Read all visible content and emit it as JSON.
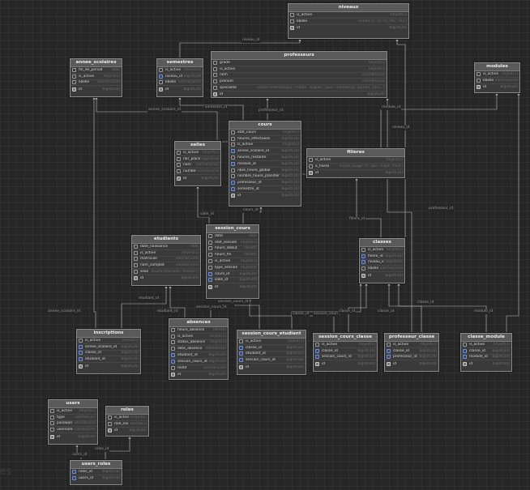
{
  "watermark": "les",
  "tables": [
    {
      "name": "niveaux",
      "fields": [
        {
          "name": "is_active",
          "type": "tinyint(1)",
          "key": ""
        },
        {
          "name": "libelle",
          "type": "enum('l1','l2','l3','m1','m2')",
          "key": ""
        },
        {
          "name": "id",
          "type": "bigint(20)",
          "key": "pk"
        }
      ]
    },
    {
      "name": "annee_scolaires",
      "fields": [
        {
          "name": "fin_de_period",
          "type": "date",
          "key": ""
        },
        {
          "name": "is_active",
          "type": "tinyint(1)",
          "key": ""
        },
        {
          "name": "libelle",
          "type": "varchar(255)",
          "key": ""
        },
        {
          "name": "id",
          "type": "bigint(20)",
          "key": "pk"
        }
      ]
    },
    {
      "name": "semestres",
      "fields": [
        {
          "name": "is_active",
          "type": "tinyint(1)",
          "key": ""
        },
        {
          "name": "niveau_id",
          "type": "bigint(20)",
          "key": "fk"
        },
        {
          "name": "libelle",
          "type": "varchar(255)",
          "key": ""
        },
        {
          "name": "id",
          "type": "bigint(20)",
          "key": "pk"
        }
      ]
    },
    {
      "name": "professeurs",
      "fields": [
        {
          "name": "grade",
          "type": "tinyint(1)",
          "key": ""
        },
        {
          "name": "is_active",
          "type": "tinyint(1)",
          "key": ""
        },
        {
          "name": "nom",
          "type": "varchar(255)",
          "key": ""
        },
        {
          "name": "prenom",
          "type": "varchar(255)",
          "key": ""
        },
        {
          "name": "specialite",
          "type": "enum('informatique','marke','anglais','java','marketing','python','phil...')",
          "key": ""
        },
        {
          "name": "id",
          "type": "bigint(20)",
          "key": "pk"
        }
      ]
    },
    {
      "name": "modules",
      "fields": [
        {
          "name": "is_active",
          "type": "tinyint(1)",
          "key": ""
        },
        {
          "name": "libelle",
          "type": "varchar(255)",
          "key": ""
        },
        {
          "name": "id",
          "type": "bigint(20)",
          "key": "pk"
        }
      ]
    },
    {
      "name": "cours",
      "fields": [
        {
          "name": "etat_cours",
          "type": "tinyint(1)",
          "key": ""
        },
        {
          "name": "heures_effectuees",
          "type": "bigint(20)",
          "key": ""
        },
        {
          "name": "is_active",
          "type": "tinyint(1)",
          "key": ""
        },
        {
          "name": "annee_scolaire_id",
          "type": "bigint(20)",
          "key": "fk"
        },
        {
          "name": "heures_restante",
          "type": "bigint(20)",
          "key": ""
        },
        {
          "name": "module_id",
          "type": "bigint(20)",
          "key": "fk"
        },
        {
          "name": "nbre_heure_global",
          "type": "bigint(20)",
          "key": ""
        },
        {
          "name": "nombre_heure_planifier",
          "type": "bigint(20)",
          "key": ""
        },
        {
          "name": "professeur_id",
          "type": "bigint(20)",
          "key": "fk"
        },
        {
          "name": "semestre_id",
          "type": "bigint(20)",
          "key": "fk"
        },
        {
          "name": "id",
          "type": "bigint(20)",
          "key": "pk"
        }
      ]
    },
    {
      "name": "salles",
      "fields": [
        {
          "name": "is_active",
          "type": "tinyint(1)",
          "key": ""
        },
        {
          "name": "nbr_place",
          "type": "bigint(20)",
          "key": ""
        },
        {
          "name": "nom",
          "type": "varchar(255)",
          "key": ""
        },
        {
          "name": "number",
          "type": "varchar(255)",
          "key": ""
        },
        {
          "name": "id",
          "type": "bigint(20)",
          "key": "pk"
        }
      ]
    },
    {
      "name": "filieres",
      "fields": [
        {
          "name": "is_active",
          "type": "tinyint(1)",
          "key": ""
        },
        {
          "name": "e_filiere",
          "type": "enum('usage','tl','gnc','mspt','tdsd')",
          "key": ""
        },
        {
          "name": "id",
          "type": "bigint(20)",
          "key": "pk"
        }
      ]
    },
    {
      "name": "session_cours",
      "fields": [
        {
          "name": "date",
          "type": "date",
          "key": ""
        },
        {
          "name": "etat_session",
          "type": "tinyint(1)",
          "key": ""
        },
        {
          "name": "heure_debut",
          "type": "time(6)",
          "key": ""
        },
        {
          "name": "heure_fin",
          "type": "time(6)",
          "key": ""
        },
        {
          "name": "is_active",
          "type": "tinyint(1)",
          "key": ""
        },
        {
          "name": "type_session",
          "type": "tinyint(4)",
          "key": ""
        },
        {
          "name": "cours_id",
          "type": "bigint(20)",
          "key": "fk"
        },
        {
          "name": "salle_id",
          "type": "bigint(20)",
          "key": "fk"
        },
        {
          "name": "id",
          "type": "bigint(20)",
          "key": "pk"
        }
      ]
    },
    {
      "name": "etudiants",
      "fields": [
        {
          "name": "date_naissance",
          "type": "date",
          "key": ""
        },
        {
          "name": "is_active",
          "type": "tinyint(1)",
          "key": ""
        },
        {
          "name": "matricule",
          "type": "varchar(255)",
          "key": ""
        },
        {
          "name": "nom_complet",
          "type": "varchar(255)",
          "key": ""
        },
        {
          "name": "sexe",
          "type": "enum('masculin','feminin')",
          "key": ""
        },
        {
          "name": "id",
          "type": "bigint(20)",
          "key": "pk"
        }
      ]
    },
    {
      "name": "classes",
      "fields": [
        {
          "name": "is_active",
          "type": "tinyint(1)",
          "key": ""
        },
        {
          "name": "filiere_id",
          "type": "bigint(20)",
          "key": "fk"
        },
        {
          "name": "niveau_id",
          "type": "bigint(20)",
          "key": "fk"
        },
        {
          "name": "libelle",
          "type": "varchar(255)",
          "key": ""
        },
        {
          "name": "id",
          "type": "bigint(20)",
          "key": "pk"
        }
      ]
    },
    {
      "name": "inscriptions",
      "fields": [
        {
          "name": "is_active",
          "type": "tinyint(1)",
          "key": ""
        },
        {
          "name": "annee_scolaire_id",
          "type": "bigint(20)",
          "key": "fk"
        },
        {
          "name": "classe_id",
          "type": "bigint(20)",
          "key": "fk"
        },
        {
          "name": "etudiant_id",
          "type": "bigint(20)",
          "key": "fk"
        },
        {
          "name": "id",
          "type": "bigint(20)",
          "key": "pk"
        }
      ]
    },
    {
      "name": "absences",
      "fields": [
        {
          "name": "heure_absence",
          "type": "time(6)",
          "key": ""
        },
        {
          "name": "is_active",
          "type": "tinyint(1)",
          "key": ""
        },
        {
          "name": "status_absence",
          "type": "tinyint(1)",
          "key": ""
        },
        {
          "name": "date_absence",
          "type": "datetime(6)",
          "key": ""
        },
        {
          "name": "etudiant_id",
          "type": "bigint(20)",
          "key": "fk"
        },
        {
          "name": "session_cours_id",
          "type": "bigint(20)",
          "key": "fk"
        },
        {
          "name": "motif",
          "type": "varchar(255)",
          "key": ""
        },
        {
          "name": "id",
          "type": "bigint(20)",
          "key": "pk"
        }
      ]
    },
    {
      "name": "session_cours_etudiant",
      "fields": [
        {
          "name": "is_active",
          "type": "tinyint(1)",
          "key": ""
        },
        {
          "name": "classe_id",
          "type": "bigint(20)",
          "key": "fk"
        },
        {
          "name": "etudiant_id",
          "type": "bigint(20)",
          "key": "fk"
        },
        {
          "name": "session_cours_id",
          "type": "bigint(20)",
          "key": "fk"
        },
        {
          "name": "id",
          "type": "bigint(20)",
          "key": "pk"
        }
      ]
    },
    {
      "name": "session_cours_classe",
      "fields": [
        {
          "name": "is_active",
          "type": "tinyint(1)",
          "key": ""
        },
        {
          "name": "classe_id",
          "type": "bigint(20)",
          "key": "fk"
        },
        {
          "name": "session_cours_id",
          "type": "bigint(20)",
          "key": "fk"
        },
        {
          "name": "id",
          "type": "bigint(20)",
          "key": "pk"
        }
      ]
    },
    {
      "name": "professeur_classe",
      "fields": [
        {
          "name": "is_active",
          "type": "tinyint(1)",
          "key": ""
        },
        {
          "name": "classe_id",
          "type": "bigint(20)",
          "key": "fk"
        },
        {
          "name": "professeur_id",
          "type": "bigint(20)",
          "key": "fk"
        },
        {
          "name": "id",
          "type": "bigint(20)",
          "key": "pk"
        }
      ]
    },
    {
      "name": "classe_module",
      "fields": [
        {
          "name": "is_active",
          "type": "tinyint(1)",
          "key": ""
        },
        {
          "name": "classe_id",
          "type": "bigint(20)",
          "key": "fk"
        },
        {
          "name": "module_id",
          "type": "bigint(20)",
          "key": "fk"
        },
        {
          "name": "id",
          "type": "bigint(20)",
          "key": "pk"
        }
      ]
    },
    {
      "name": "users",
      "fields": [
        {
          "name": "is_active",
          "type": "tinyint(1)",
          "key": ""
        },
        {
          "name": "type",
          "type": "varchar(31)",
          "key": ""
        },
        {
          "name": "password",
          "type": "varchar(255)",
          "key": ""
        },
        {
          "name": "username",
          "type": "varchar(255)",
          "key": ""
        },
        {
          "name": "id",
          "type": "bigint(20)",
          "key": "pk"
        }
      ]
    },
    {
      "name": "roles",
      "fields": [
        {
          "name": "is_active",
          "type": "tinyint(1)",
          "key": ""
        },
        {
          "name": "role_name",
          "type": "varchar(255)",
          "key": ""
        },
        {
          "name": "id",
          "type": "bigint(20)",
          "key": "pk"
        }
      ]
    },
    {
      "name": "users_roles",
      "fields": [
        {
          "name": "roles_id",
          "type": "bigint(20)",
          "key": "fk"
        },
        {
          "name": "users_id",
          "type": "bigint(20)",
          "key": "fk"
        }
      ]
    }
  ],
  "relationships": [
    {
      "label": "niveau_id",
      "from": "semestres",
      "to": "niveaux"
    },
    {
      "label": "niveau_id",
      "from": "classes",
      "to": "niveaux"
    },
    {
      "label": "annee_scolaire_id",
      "from": "cours",
      "to": "annee_scolaires"
    },
    {
      "label": "semestre_id",
      "from": "cours",
      "to": "semestres"
    },
    {
      "label": "professeur_id",
      "from": "cours",
      "to": "professeurs"
    },
    {
      "label": "module_id",
      "from": "cours",
      "to": "modules"
    },
    {
      "label": "salle_id",
      "from": "session_cours",
      "to": "salles"
    },
    {
      "label": "cours_id",
      "from": "session_cours",
      "to": "cours"
    },
    {
      "label": "filiere_id",
      "from": "classes",
      "to": "filieres"
    },
    {
      "label": "professeur_id",
      "from": "professeur_classe",
      "to": "professeurs"
    },
    {
      "label": "annee_scolaire_id",
      "from": "inscriptions",
      "to": "annee_scolaires"
    },
    {
      "label": "etudiant_id",
      "from": "inscriptions",
      "to": "etudiants"
    },
    {
      "label": "etudiant_id",
      "from": "absences",
      "to": "etudiants"
    },
    {
      "label": "session_cours_id",
      "from": "absences",
      "to": "session_cours"
    },
    {
      "label": "session_cours_id",
      "from": "session_cours_etudiant",
      "to": "session_cours"
    },
    {
      "label": "classe_id",
      "from": "session_cours_etudiant",
      "to": "classes"
    },
    {
      "label": "session_cours_id",
      "from": "session_cours_classe",
      "to": "session_cours"
    },
    {
      "label": "classe_id",
      "from": "session_cours_classe",
      "to": "classes"
    },
    {
      "label": "classe_id",
      "from": "professeur_classe",
      "to": "classes"
    },
    {
      "label": "classe_id",
      "from": "classe_module",
      "to": "classes"
    },
    {
      "label": "module_id",
      "from": "classe_module",
      "to": "modules"
    },
    {
      "label": "roles_id",
      "from": "users_roles",
      "to": "roles"
    },
    {
      "label": "users_id",
      "from": "users_roles",
      "to": "users"
    }
  ]
}
